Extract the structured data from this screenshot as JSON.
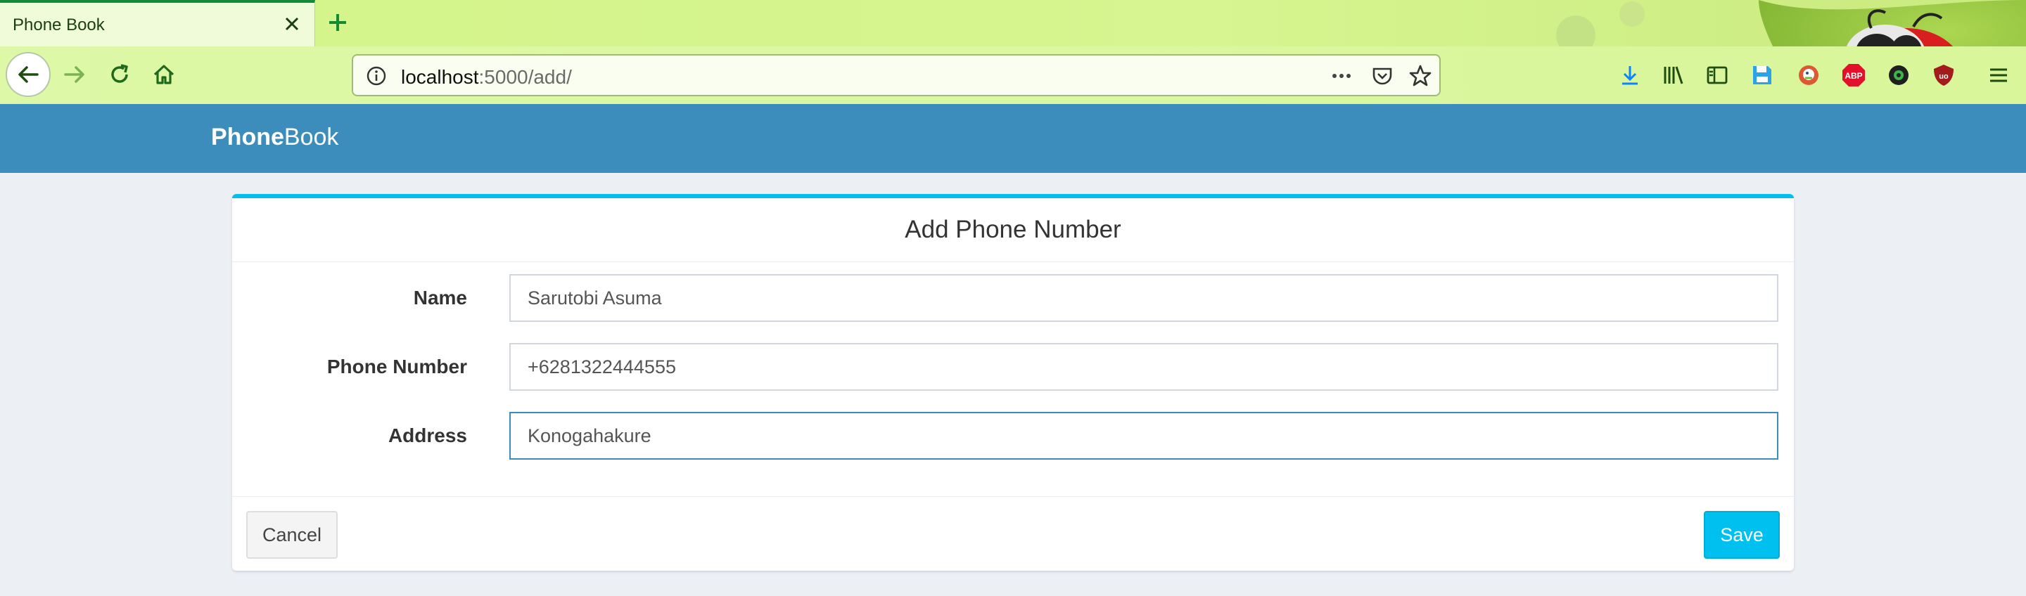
{
  "browser": {
    "tab_title": "Phone Book",
    "url_host": "localhost",
    "url_rest": ":5000/add/",
    "theme_colors": {
      "tab_accent": "#128a36",
      "chrome": "#d7f590"
    },
    "icons": [
      "back-arrow-icon",
      "forward-arrow-icon",
      "reload-icon",
      "home-icon",
      "info-icon",
      "more-icon",
      "pocket-icon",
      "bookmark-star-icon",
      "download-icon",
      "library-icon",
      "sidebar-icon",
      "save-icon",
      "duckduckgo-icon",
      "adblock-plus-icon",
      "privacy-badger-icon",
      "ublock-origin-icon",
      "menu-icon"
    ],
    "adblock_label": "ABP",
    "ublock_label": "uo"
  },
  "app": {
    "brand_bold": "Phone",
    "brand_light": "Book",
    "header_color": "#3c8dbc"
  },
  "form": {
    "title": "Add Phone Number",
    "fields": [
      {
        "label": "Name",
        "value": "Sarutobi Asuma"
      },
      {
        "label": "Phone Number",
        "value": "+6281322444555"
      },
      {
        "label": "Address",
        "value": "Konogahakure"
      }
    ],
    "cancel_label": "Cancel",
    "save_label": "Save",
    "accent_color": "#00c0ef"
  }
}
